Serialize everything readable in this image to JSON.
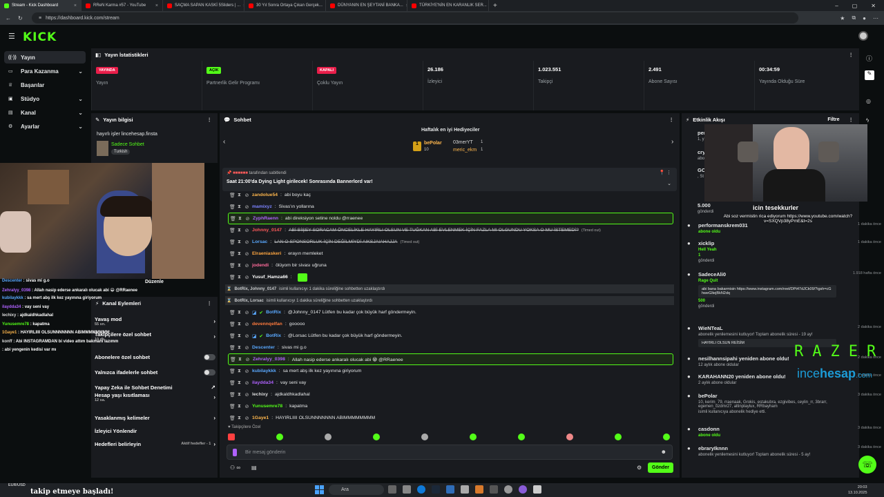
{
  "browser": {
    "tabs": [
      {
        "title": "Stream - Kick Dashboard",
        "color": "#53fc18",
        "active": true
      },
      {
        "title": "RReN Karma #57 - YouTube",
        "color": "#ff0000"
      },
      {
        "title": "SAÇMA SAPAN KASKİ 5Sliders | ...",
        "color": "#ff0000"
      },
      {
        "title": "30 Yıl Sonra Ortaya Çıkan Gerçek...",
        "color": "#ff0000"
      },
      {
        "title": "DÜNYANIN EN ŞEYTANİ BANKA...",
        "color": "#ff0000"
      },
      {
        "title": "TÜRKİYE'NİN EN KARANLIK SER...",
        "color": "#ff0000"
      }
    ],
    "url": "https://dashboard.kick.com/stream"
  },
  "header": {
    "logo": "KICK",
    "logo_sup": "BETA"
  },
  "nav": [
    {
      "label": "Yayın",
      "icon": "broadcast-icon",
      "selected": true
    },
    {
      "label": "Para Kazanma",
      "icon": "money-icon",
      "chevron": true
    },
    {
      "label": "Başarılar",
      "icon": "trophy-icon"
    },
    {
      "label": "Stüdyo",
      "icon": "studio-icon",
      "chevron": true
    },
    {
      "label": "Kanal",
      "icon": "channel-icon",
      "chevron": true
    },
    {
      "label": "Ayarlar",
      "icon": "settings-icon",
      "chevron": true
    }
  ],
  "stats": {
    "title": "Yayın İstatistikleri",
    "cells": [
      {
        "tag": "YAYINDA",
        "tag_color": "#e91e4a",
        "label": "Yayın"
      },
      {
        "tag": "AÇIK",
        "tag_color": "#53fc18",
        "label": "Partnerlik Gelir Programı"
      },
      {
        "tag": "KAPALI",
        "tag_color": "#e91e4a",
        "label": "Çoklu Yayın"
      },
      {
        "value": "26.186",
        "label": "İzleyici"
      },
      {
        "value": "1.023.551",
        "label": "Takipçi"
      },
      {
        "value": "2.491",
        "label": "Abone Sayısı"
      },
      {
        "value": "00:34:59",
        "label": "Yayında Olduğu Süre"
      }
    ]
  },
  "stream_info": {
    "title": "Yayın bilgisi",
    "stream_title": "hayırlı işler lincehesap.finsta",
    "category": "Sadece Sohbet",
    "tag": "Turkish"
  },
  "chat": {
    "title": "Sohbet",
    "gifters_title": "Haftalık en iyi Hediyeciler",
    "gifters": [
      {
        "name": "bePolar",
        "count": "10"
      },
      {
        "name": "03merYT",
        "count": "1"
      },
      {
        "name": "meric_ekm",
        "count": "1"
      }
    ],
    "pinned_by": "tarafından sabitlendi",
    "pinned_text": "Saat 21:00'da Dying Light girilecek! Sonrasında Bannerlord var!",
    "messages": [
      {
        "user": "zandolue54",
        "color": "#ffb74d",
        "text": "abi boyu kaç"
      },
      {
        "user": "mamixyz",
        "color": "#7c83ff",
        "text": "Sivas'ın yollarına"
      },
      {
        "user": "ZyphRaenn",
        "color": "#b062ff",
        "text": "abi direksiyon setine noldu @rraenee",
        "hl": true
      },
      {
        "user": "Johnny_0147",
        "color": "#ff5a5a",
        "text": "ABİ BİŞEY SORACAM ÖNCELİKLE HAYIRLI OLSUN VE TUĞKAN ABİ EVLENMEK İÇİN FAZLA MI OLGUNDU YOKSA O MU İSTEMEDİ?",
        "suffix": "(Timed out)",
        "strike": true
      },
      {
        "user": "Lorsac",
        "color": "#5aa9ff",
        "text": "LAN O SPONSORLUK İÇİN DEĞİLMİYDİ AIKSJAIAHAJJA",
        "suffix": "(Timed out)",
        "strike": true
      },
      {
        "user": "Elraeniaskeri",
        "color": "#ffa640",
        "text": "erayın memleket"
      },
      {
        "user": "jodendi",
        "color": "#ff6b9b",
        "text": "ölüyom bir sivası uğruna"
      },
      {
        "user": "Yusuf_Hamza66",
        "color": "#ffffff",
        "text": ""
      },
      {
        "system": true,
        "user": "BotRix, Johnny_0147",
        "text": "isimli kullanıcıyı 1 dakika süreliğine sohbetten uzaklaştırdı"
      },
      {
        "system": true,
        "user": "BotRix, Lorsac",
        "text": "isimli kullanıcıyı 1 dakika süreliğine sohbetten uzaklaştırdı"
      },
      {
        "user": "BotRix",
        "color": "#5aa9ff",
        "text": "@Johnny_0147 Lütfen bu kadar çok büyük harf göndermeyin."
      },
      {
        "user": "devennqelfan",
        "color": "#ff7b3d",
        "text": "gooooo"
      },
      {
        "user": "BotRix",
        "color": "#5aa9ff",
        "text": "@Lorsac Lütfen bu kadar çok büyük harf göndermeyin."
      },
      {
        "user": "Descenter",
        "color": "#5aa9ff",
        "text": "sivas mi g.o"
      },
      {
        "user": "Zehralyy_0398",
        "color": "#b062ff",
        "text": "Allah nasip ederse ankaralı olucak abi 😁 @RRaenee",
        "hl": true
      },
      {
        "user": "kubilaykkk",
        "color": "#5aa9ff",
        "text": "sa mert abş ilk kez yayınına giriyorum"
      },
      {
        "user": "ilaydda34",
        "color": "#b062ff",
        "text": "vay seni vay"
      },
      {
        "user": "lechixy",
        "color": "#dddddd",
        "text": "ajdkaldhkadlahal"
      },
      {
        "user": "Yunusemre78",
        "color": "#53fc18",
        "text": "kapatma"
      },
      {
        "user": "1Gaye1",
        "color": "#ffb74d",
        "text": "HAYIRLIIII OLSUNNNNNNN ABIMMMMMMMM"
      }
    ],
    "follower_only": "Takipçilere Özel",
    "input_placeholder": "Bir mesaj gönderin",
    "send_label": "Gönder"
  },
  "actions": {
    "title": "Kanal Eylemleri",
    "items": [
      {
        "label": "Yavaş mod",
        "sub": "55 sn.",
        "arrow": true
      },
      {
        "label": "Takipçilere özel sohbet",
        "sub": "10 dk.",
        "arrow": true
      },
      {
        "label": "Abonelere özel sohbet",
        "toggle": true
      },
      {
        "label": "Yalnızca ifadelerle sohbet",
        "toggle": true
      },
      {
        "label": "Yapay Zeka ile Sohbet Denetimi",
        "ext": true
      },
      {
        "label": "Hesap yaşı kısıtlaması",
        "sub": "12 sa.",
        "arrow": true
      },
      {
        "label": "Yasaklanmış kelimeler",
        "arrow": true
      },
      {
        "label": "İzleyici Yönlendir"
      },
      {
        "label": "Hedefleri belirleyin",
        "right": "Aktif hedefler - 1",
        "arrow": true
      }
    ],
    "edit_label": "Düzenle"
  },
  "feed": {
    "title": "Etkinlik Akışı",
    "filter": "Filtre",
    "items": [
      {
        "title": "performanskrem031",
        "sub": "abone oldu",
        "when": "1 dakika önce"
      },
      {
        "title": "xicklip",
        "sub": "Hell Yeah",
        "extra": "1",
        "sub2": "gönderdi",
        "when": "1 dakika önce"
      },
      {
        "title": "SadeceAli0",
        "sub": "Rage Quit",
        "msg": "abi bana bakarmisin https://www.instagram.com/reel/DPt47dJCk09/?igsh=cGhweGltejBkN2dq",
        "extra": "500",
        "sub2": "gönderdi",
        "when": "1.918 hafta önce"
      },
      {
        "title": "WieNTeaL",
        "sub": "abonelik yenilemesini kutluyor! Toplam abonelik süresi - 19 ay!",
        "msg": "HAYIRLI OLSUN REİSİM",
        "when": "2 dakika önce"
      },
      {
        "title": "nesilhannsipahi yeniden abone oldu!",
        "sub": "12 aylık abone oldular",
        "when": "2 dakika önce"
      },
      {
        "title": "KARAHANN20 yeniden abone oldu!",
        "sub": "2 aylık abone oldular",
        "when": "2 dakika önce"
      },
      {
        "title": "bePolar",
        "sub": "10, kerim_79, rraenaak, Grokis, estakubra, ezgivibes, ceylin_rr, 3brarr, egemen_ozdmr27, altinplaylux, RRbayham",
        "sub2": "isimli kullanıcıya abonelik hediye etti.",
        "when": "3 dakika önce"
      },
      {
        "title": "casdonn",
        "sub": "abone oldu",
        "when": "3 dakika önce"
      },
      {
        "title": "ebraryIknnn",
        "sub": "abonelik yenilemesini kutluyor! Toplam abonelik süresi - 5 ay!",
        "when": "3 dakika önce"
      }
    ],
    "partial": [
      {
        "title": "per",
        "sub": "1, y"
      },
      {
        "title": "cry",
        "sub": "abone"
      },
      {
        "title": "GO",
        "sub": ", St"
      },
      {
        "title": "5.000",
        "sub": "gönderdi"
      }
    ]
  },
  "overlay": {
    "thanks": "icin tesekkurler",
    "promise": "Abi soz vermistin rica ediyorum https://www.youtube.com/watch?v=SXQVp38yPmE&t=2s",
    "brand1": "RAZER",
    "brand2_a": "ince",
    "brand2_b": "hesap",
    "brand2_c": ".com",
    "follow_text": "takip etmeye başladı!",
    "stock": "EUR/USD"
  },
  "overlay_chat": [
    {
      "user": "Descenter",
      "color": "#5aa9ff",
      "text": "sivas mi g.o"
    },
    {
      "user": "Zehralyy_0398",
      "color": "#b062ff",
      "text": "Allah nasip ederse ankaralı olucak abi 😁 @RRaenee"
    },
    {
      "user": "kubilaykkk",
      "color": "#5aa9ff",
      "text": "sa mert abş ilk kez yayınına giriyorum"
    },
    {
      "user": "ilaydda34",
      "color": "#b062ff",
      "text": "vay seni vay"
    },
    {
      "user": "lechixy",
      "color": "#dddddd",
      "text": "ajdkaldhkadlahal"
    },
    {
      "user": "Yunusemre78",
      "color": "#53fc18",
      "text": "kapatma"
    },
    {
      "user": "1Gaye1",
      "color": "#ffb74d",
      "text": "HAYIRLIIII OLSUNNNNNNN ABIMMMMMMMM"
    },
    {
      "user": "konff",
      "color": "#dddddd",
      "text": "Abi INSTAGRAMDAN bi video attım bakmanı lazımm"
    },
    {
      "user": "",
      "color": "#ff5a5a",
      "text": "abi yengenin kedisi var mı"
    }
  ],
  "taskbar": {
    "search": "Ara",
    "time": "20:03",
    "date": "13.10.2025"
  }
}
